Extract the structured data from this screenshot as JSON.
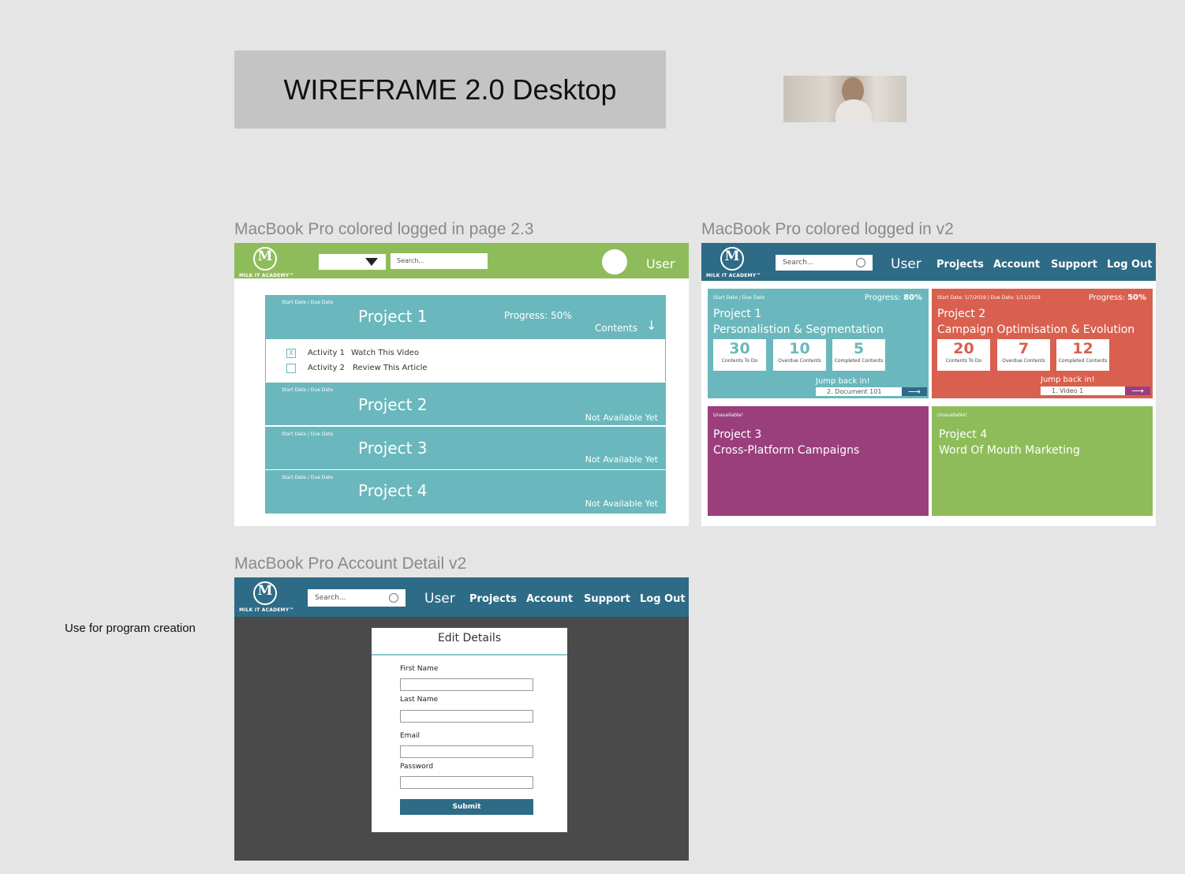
{
  "page_title": "WIREFRAME 2.0 Desktop",
  "note": "Use for program creation",
  "frames": {
    "f1_label": "MacBook Pro colored logged in page 2.3",
    "f2_label": "MacBook Pro colored logged in v2",
    "f3_label": "MacBook Pro Account Detail v2"
  },
  "brand": {
    "logo_letter": "M",
    "logo_text": "MILK IT ACADEMY™"
  },
  "f1": {
    "search_placeholder": "Search...",
    "user": "User",
    "projects": [
      {
        "date": "Start Date / Due Date",
        "name": "Project 1",
        "progress": "Progress: 50%",
        "contents": "Contents",
        "arrow": "↓"
      },
      {
        "date": "Start Date / Due Date",
        "name": "Project 2",
        "status": "Not Available Yet"
      },
      {
        "date": "Start Date / Due Date",
        "name": "Project 3",
        "status": "Not Available Yet"
      },
      {
        "date": "Start Date / Due Date",
        "name": "Project 4",
        "status": "Not Available Yet"
      }
    ],
    "activities": [
      {
        "check": "X",
        "label": "Activity 1",
        "desc": "Watch This Video"
      },
      {
        "check": "",
        "label": "Activity 2",
        "desc": "Review This Article"
      }
    ]
  },
  "nav": {
    "search_placeholder": "Search...",
    "user": "User",
    "items": [
      "Projects",
      "Account",
      "Support",
      "Log Out"
    ]
  },
  "f2": {
    "cards": [
      {
        "date": "Start Date / Due Date",
        "progress_label": "Progress:",
        "progress": "80%",
        "title": "Project 1",
        "subtitle": "Personalistion & Segmentation",
        "stats": [
          {
            "n": "30",
            "l": "Contents To Do"
          },
          {
            "n": "10",
            "l": "Overdue Contents"
          },
          {
            "n": "5",
            "l": "Completed Contents"
          }
        ],
        "jump": "Jump back in!",
        "resume": "2. Document 101",
        "arrow": "⟶"
      },
      {
        "date": "Start Date: 1/7/2019 | Due Date: 1/11/2019",
        "progress_label": "Progress:",
        "progress": "50%",
        "title": "Project 2",
        "subtitle": "Campaign Optimisation & Evolution",
        "stats": [
          {
            "n": "20",
            "l": "Contents To Do"
          },
          {
            "n": "7",
            "l": "Overdue Contents"
          },
          {
            "n": "12",
            "l": "Completed Contents"
          }
        ],
        "jump": "Jump back in!",
        "resume": "1. Video 1",
        "arrow": "⟶"
      },
      {
        "date": "Unavailable!",
        "title": "Project 3",
        "subtitle": "Cross-Platform Campaigns"
      },
      {
        "date": "Unavailable!",
        "title": "Project 4",
        "subtitle": "Word Of Mouth Marketing"
      }
    ]
  },
  "f3": {
    "heading": "Edit Details",
    "fields": [
      {
        "label": "First Name",
        "value": ""
      },
      {
        "label": "Last Name",
        "value": ""
      },
      {
        "label": "Email",
        "value": ""
      },
      {
        "label": "Password",
        "value": ""
      }
    ],
    "submit": "Submit"
  },
  "colors": {
    "green": "#8fbc5a",
    "teal": "#6ab8bd",
    "navy": "#2e6b86",
    "card1": "#6ab8bd",
    "card2": "#d9604f",
    "card3": "#9a3f7c",
    "card4": "#8fbc5a"
  }
}
